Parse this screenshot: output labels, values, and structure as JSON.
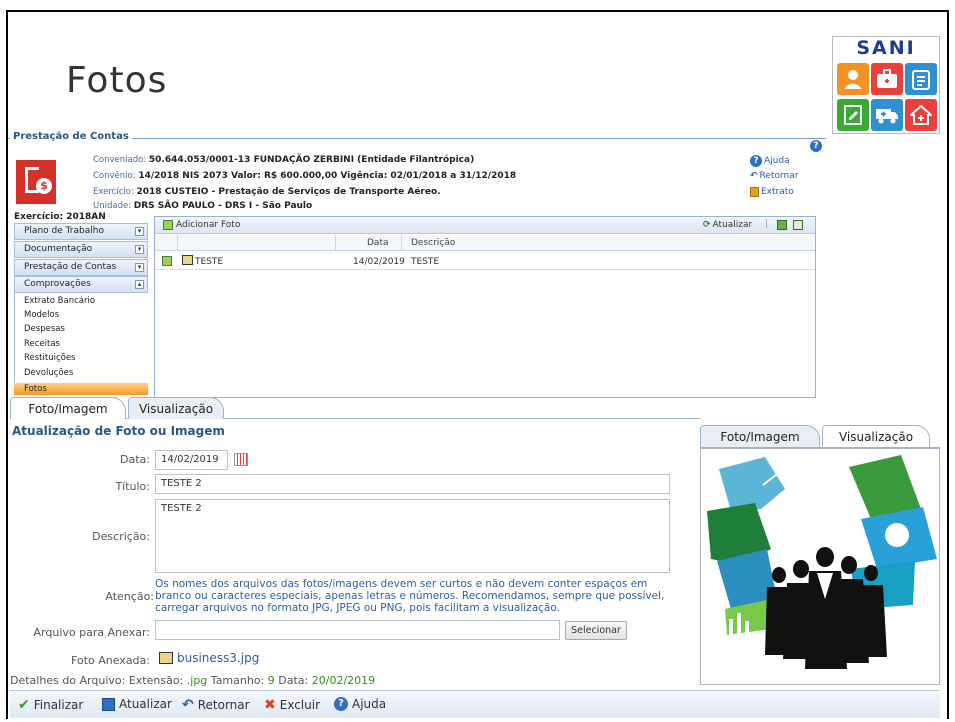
{
  "page": {
    "title": "Fotos"
  },
  "logo": {
    "text": "SANI"
  },
  "panel": {
    "legend": "Prestação de Contas",
    "conveniado_label": "Conveniado:",
    "conveniado_value": "50.644.053/0001-13  FUNDAÇÃO ZERBINI  (Entidade Filantrópica)",
    "convenio_label": "Convênio:",
    "convenio_value": "14/2018 NIS 2073 Valor: R$ 600.000,00 Vigência: 02/01/2018 a 31/12/2018",
    "exercicio_label": "Exercício:",
    "exercicio_value": "2018  CUSTEIO - Prestação de Serviços de Transporte Aéreo.",
    "unidade_label": "Unidade:",
    "unidade_value": "DRS SÃO PAULO - DRS I - São Paulo",
    "links": {
      "ajuda": "Ajuda",
      "retornar": "Retornar",
      "extrato": "Extrato"
    }
  },
  "nav": {
    "exercicio": "Exercício: 2018AN",
    "sections": [
      "Plano de Trabalho",
      "Documentação",
      "Prestação de Contas",
      "Comprovações"
    ],
    "items": [
      "Extrato Bancário",
      "Modelos",
      "Despesas",
      "Receitas",
      "Restituições",
      "Devoluções"
    ],
    "active": "Fotos"
  },
  "grid": {
    "add_label": "Adicionar Foto",
    "refresh_label": "Atualizar",
    "columns": [
      "Data",
      "Descrição"
    ],
    "rows": [
      {
        "name": "TESTE",
        "date": "14/02/2019",
        "description": "TESTE"
      }
    ]
  },
  "tabs": {
    "foto": "Foto/Imagem",
    "visualizacao": "Visualização"
  },
  "form": {
    "title": "Atualização de Foto ou Imagem",
    "data_label": "Data:",
    "data_value": "14/02/2019",
    "titulo_label": "Título:",
    "titulo_value": "TESTE 2",
    "descricao_label": "Descrição:",
    "descricao_value": "TESTE 2",
    "atencao_label": "Atenção:",
    "atencao_text": "Os nomes dos arquivos das fotos/imagens devem ser curtos e não devem conter espaços em branco ou caracteres especiais, apenas letras e números. Recomendamos, sempre que possível, carregar arquivos no formato JPG, JPEG ou PNG, pois facilitam a visualização.",
    "arquivo_label": "Arquivo para Anexar:",
    "arquivo_value": "",
    "selecionar": "Selecionar",
    "foto_anexada_label": "Foto Anexada:",
    "foto_anexada_value": "business3.jpg",
    "detalhes_label": "Detalhes do Arquivo:",
    "extensao_label": "Extensão:",
    "extensao_value": ".jpg",
    "tamanho_label": "Tamanho:",
    "tamanho_value": "9",
    "data2_label": "Data:",
    "data2_value": "20/02/2019"
  },
  "toolbar": {
    "finalizar": "Finalizar",
    "atualizar": "Atualizar",
    "retornar": "Retornar",
    "excluir": "Excluir",
    "ajuda": "Ajuda"
  }
}
